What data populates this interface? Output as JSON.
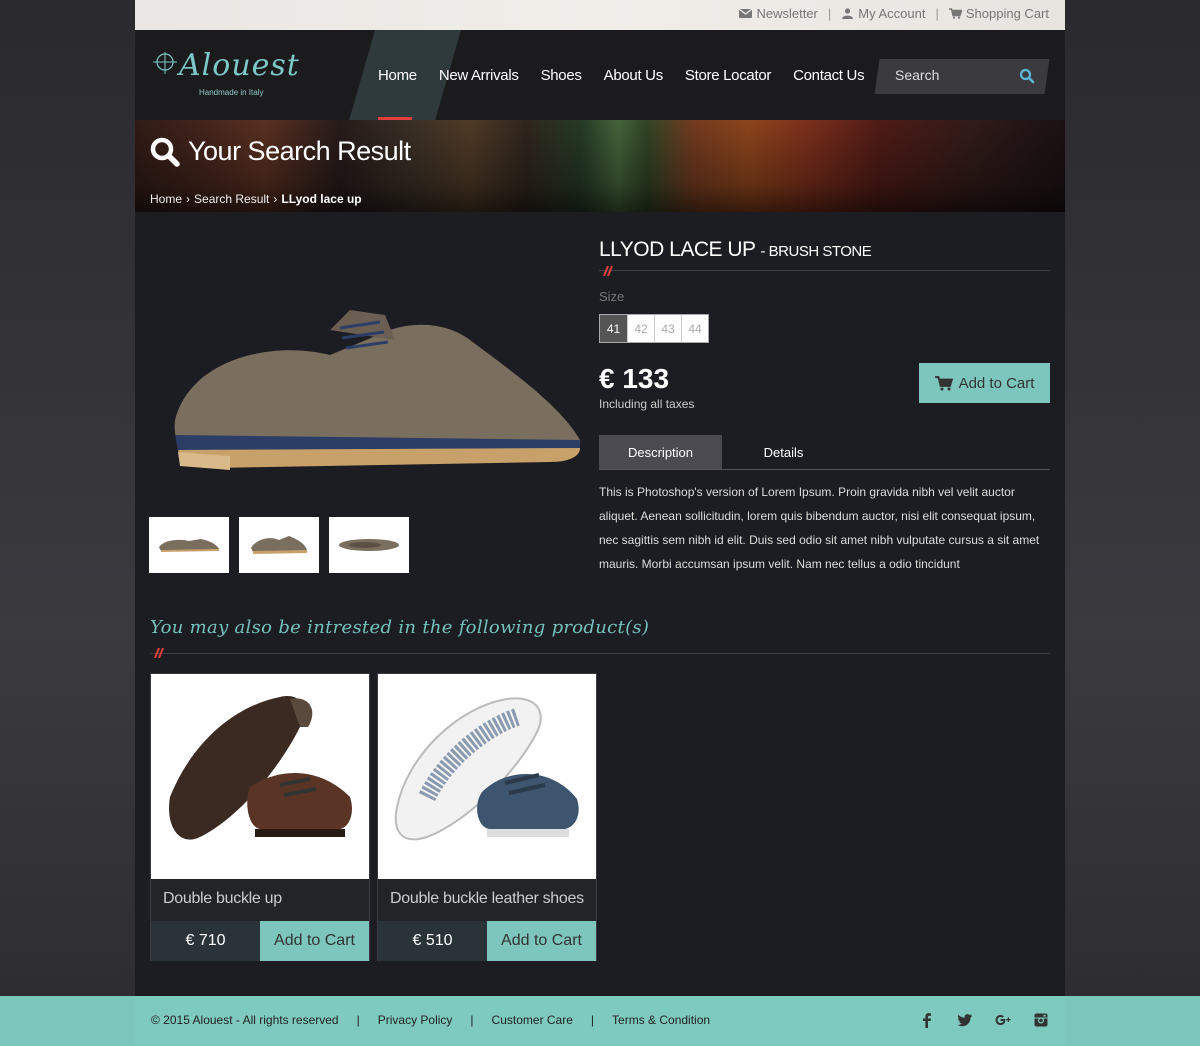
{
  "topbar": {
    "newsletter": "Newsletter",
    "account": "My Account",
    "cart": "Shopping Cart"
  },
  "brand": {
    "name": "Alouest",
    "tagline": "Handmade in Italy"
  },
  "nav": {
    "home": "Home",
    "new_arrivals": "New Arrivals",
    "shoes": "Shoes",
    "about": "About Us",
    "store_locator": "Store Locator",
    "contact": "Contact Us"
  },
  "search": {
    "placeholder": "Search"
  },
  "banner": {
    "title": "Your Search Result",
    "crumb_home": "Home",
    "crumb_search": "Search Result",
    "crumb_current": "LLyod lace up"
  },
  "product": {
    "name": "LLYOD LACE UP",
    "variant": "- BRUSH STONE",
    "size_label": "Size",
    "sizes": [
      "41",
      "42",
      "43",
      "44"
    ],
    "selected_size": "41",
    "price": "€ 133",
    "taxes": "Including all taxes",
    "add_to_cart": "Add to Cart",
    "tab_description": "Description",
    "tab_details": "Details",
    "description": "This is Photoshop's version  of Lorem Ipsum. Proin gravida nibh vel velit auctor aliquet. Aenean sollicitudin, lorem quis bibendum auctor, nisi elit consequat ipsum, nec sagittis sem nibh id elit. Duis sed odio sit amet nibh vulputate cursus a sit amet mauris. Morbi accumsan ipsum velit. Nam nec tellus a odio tincidunt"
  },
  "related": {
    "title": "You may also be intrested in the following product(s)",
    "items": [
      {
        "name": "Double buckle up",
        "price": "€ 710",
        "add": "Add to Cart"
      },
      {
        "name": "Double buckle leather shoes",
        "price": "€ 510",
        "add": "Add to Cart"
      }
    ]
  },
  "footer": {
    "copyright": "© 2015 Alouest - All rights reserved",
    "privacy": "Privacy Policy",
    "care": "Customer Care",
    "terms": "Terms & Condition",
    "sep": "|"
  },
  "colors": {
    "accent": "#7cc6bd",
    "red": "#e5403c",
    "dark": "#1c1d22"
  },
  "icons": [
    "envelope-icon",
    "user-icon",
    "cart-icon",
    "search-icon",
    "facebook-icon",
    "twitter-icon",
    "google-plus-icon",
    "instagram-icon"
  ]
}
